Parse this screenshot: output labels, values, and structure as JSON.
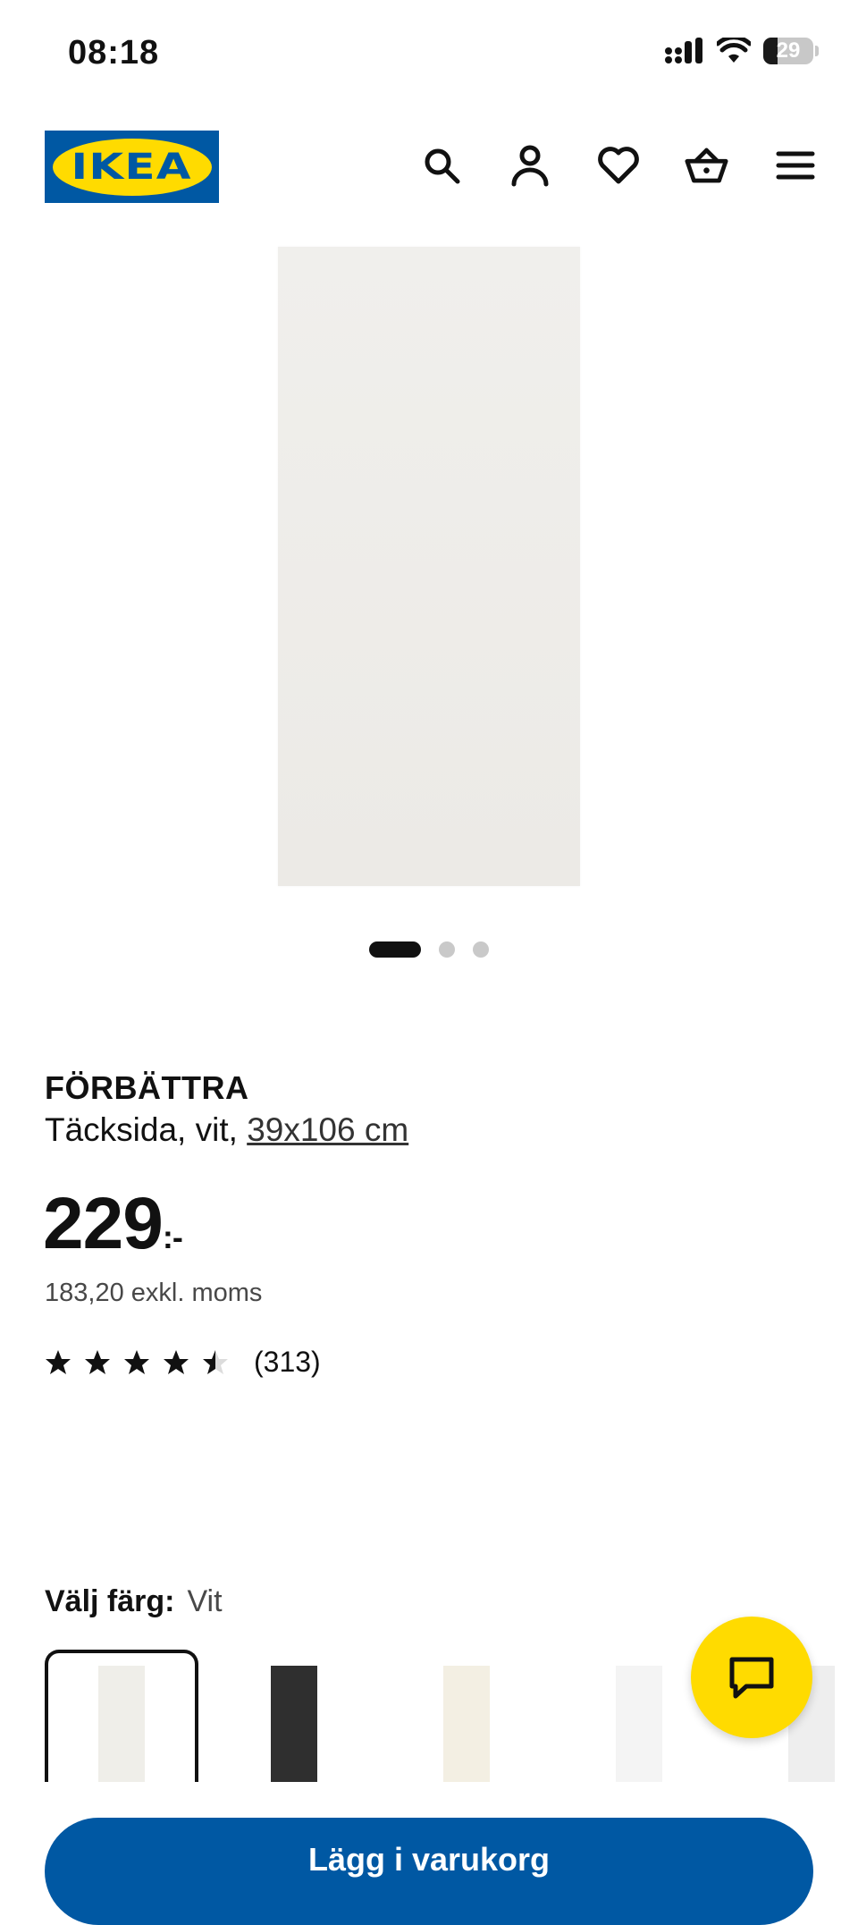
{
  "status_bar": {
    "time": "08:18",
    "battery": "29",
    "battery_level": 0.29,
    "icons": [
      "signal-icon",
      "wifi-icon",
      "battery-icon"
    ]
  },
  "header": {
    "logo": "IKEA",
    "icons": [
      "search-icon",
      "account-icon",
      "heart-icon",
      "basket-icon",
      "menu-icon"
    ]
  },
  "gallery": {
    "image_count": 3,
    "active_index": 0
  },
  "product": {
    "name": "FÖRBÄTTRA",
    "description": "Täcksida, vit, ",
    "size_link": "39x106 cm",
    "price": "229",
    "price_suffix": ":-",
    "price_ex_vat": "183,20 exkl. moms",
    "rating": 4.5,
    "review_count": "(313)"
  },
  "color_selector": {
    "label": "Välj färg:",
    "selected_value": "Vit",
    "swatch_colors": [
      "#efeee9",
      "#2f2f2f",
      "#f3efe3",
      "#f4f4f4",
      "#eeeeee"
    ],
    "selected_index": 0
  },
  "chat": {
    "icon": "chat-icon",
    "color": "#ffdb00"
  },
  "cta": {
    "label": "Lägg i varukorg",
    "color": "#0058a3"
  }
}
